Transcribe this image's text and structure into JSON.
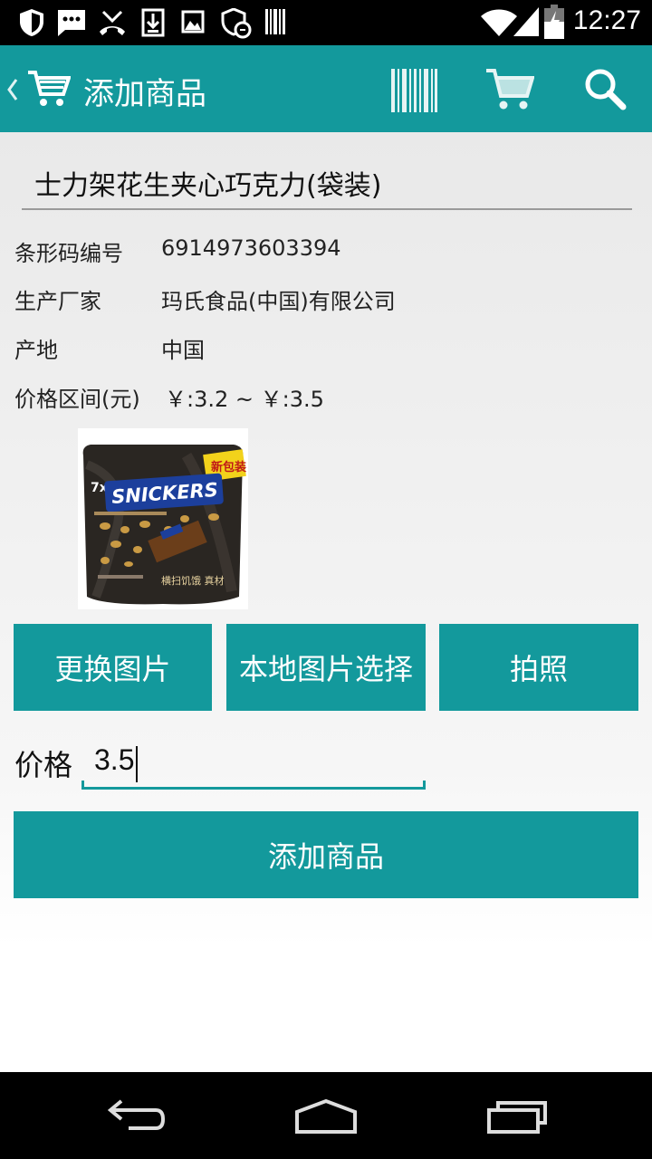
{
  "status_bar": {
    "time": "12:27",
    "left_icons": [
      "shield-icon",
      "message-icon",
      "missed-call-icon",
      "download-icon",
      "image-icon",
      "security-icon",
      "barcode-icon"
    ],
    "right_icons": [
      "wifi-icon",
      "signal-icon",
      "battery-icon"
    ]
  },
  "action_bar": {
    "title": "添加商品",
    "actions": [
      "barcode-scan-icon",
      "cart-icon",
      "search-icon"
    ],
    "color": "#13999c"
  },
  "product": {
    "name": "士力架花生夹心巧克力(袋装)",
    "barcode_label": "条形码编号",
    "barcode_value": "6914973603394",
    "manufacturer_label": "生产厂家",
    "manufacturer_value": "玛氏食品(中国)有限公司",
    "origin_label": "产地",
    "origin_value": "中国",
    "price_range_label": "价格区间(元)",
    "price_range_value": "￥:3.2 ~ ￥:3.5",
    "image": {
      "brand_text": "SNICKERS",
      "badge_text": "新包装",
      "count_text": "7x",
      "bottom_text": "横扫饥饿 真材"
    }
  },
  "buttons": {
    "change_image": "更换图片",
    "local_image": "本地图片选择",
    "take_photo": "拍照",
    "add_product": "添加商品"
  },
  "price_field": {
    "label": "价格",
    "value": "3.5"
  }
}
